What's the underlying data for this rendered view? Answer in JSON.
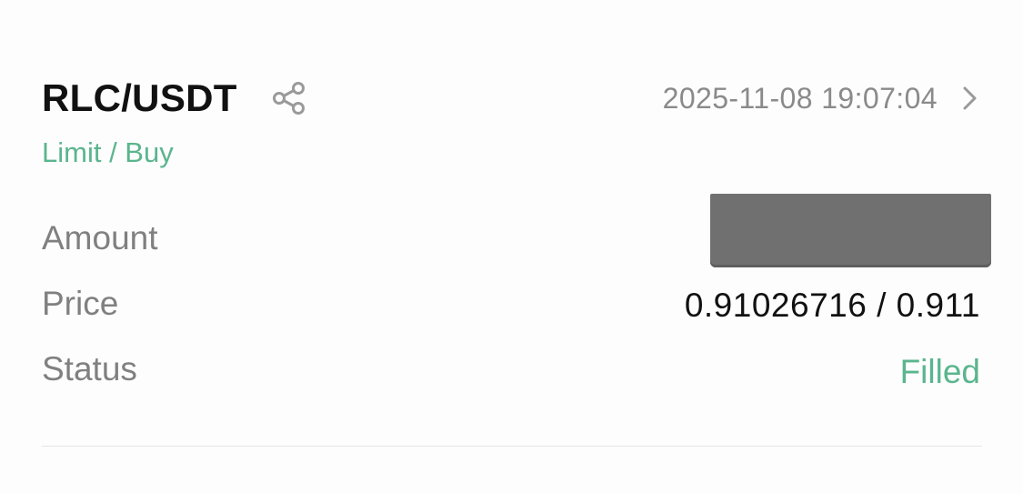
{
  "order": {
    "pair": "RLC/USDT",
    "timestamp": "2025-11-08 19:07:04",
    "type": "Limit / Buy",
    "rows": {
      "amount": {
        "label": "Amount"
      },
      "price": {
        "label": "Price",
        "value": "0.91026716 / 0.911"
      },
      "status": {
        "label": "Status",
        "value": "Filled"
      }
    }
  },
  "icons": {
    "share": "share-icon",
    "chevron": "chevron-right-icon"
  },
  "colors": {
    "accent_green": "#5bb58e",
    "primary_text": "#111111",
    "secondary_text": "#808080",
    "timestamp_text": "#8a8a8a",
    "redaction": "#707070"
  }
}
